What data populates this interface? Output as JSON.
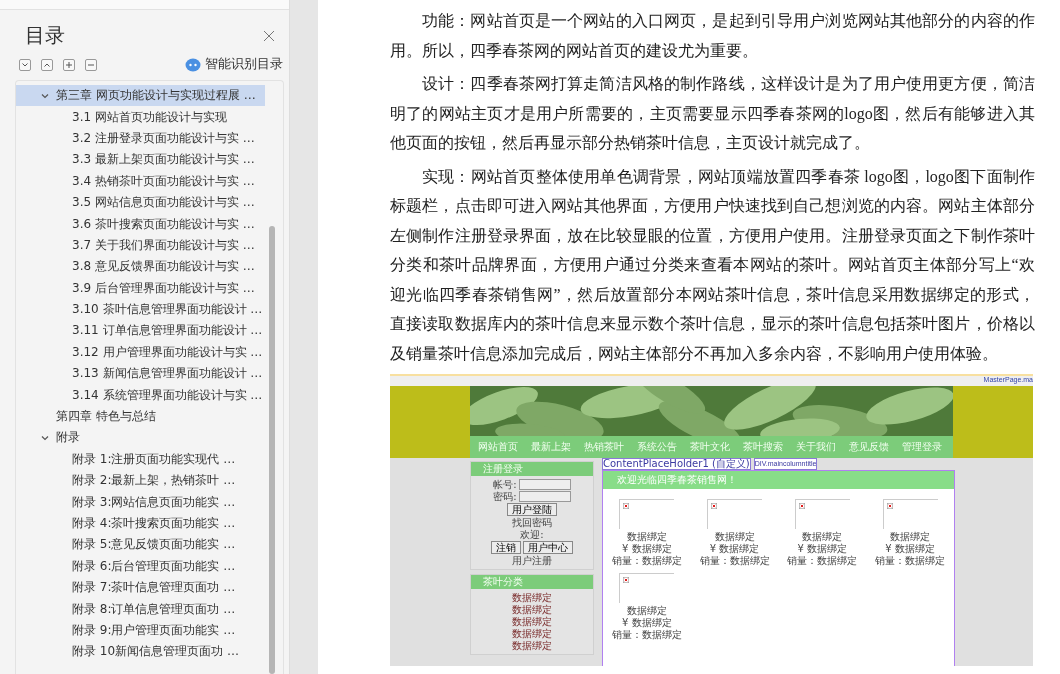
{
  "sidebar": {
    "title": "目录",
    "smart_toc": "智能识别目录",
    "tree": [
      {
        "label": "第三章 网页功能设计与实现过程展 …",
        "selected": true,
        "expanded": true,
        "children": [
          {
            "label": "3.1 网站首页功能设计与实现",
            "selected": false
          },
          {
            "label": "3.2 注册登录页面功能设计与实 …",
            "selected": false
          },
          {
            "label": "3.3 最新上架页面功能设计与实 …",
            "selected": false
          },
          {
            "label": "3.4 热销茶叶页面功能设计与实 …",
            "selected": false
          },
          {
            "label": "3.5 网站信息页面功能设计与实 …",
            "selected": false
          },
          {
            "label": "3.6 茶叶搜索页面功能设计与实 …",
            "selected": false
          },
          {
            "label": "3.7 关于我们界面功能设计与实 …",
            "selected": false
          },
          {
            "label": "3.8 意见反馈界面功能设计与实 …",
            "selected": false
          },
          {
            "label": "3.9 后台管理界面功能设计与实 …",
            "selected": false
          },
          {
            "label": "3.10 茶叶信息管理界面功能设计 …",
            "selected": false
          },
          {
            "label": "3.11 订单信息管理界面功能设计 …",
            "selected": false
          },
          {
            "label": "3.12 用户管理界面功能设计与实 …",
            "selected": false
          },
          {
            "label": "3.13 新闻信息管理界面功能设计 …",
            "selected": false
          },
          {
            "label": "3.14 系统管理界面功能设计与实 …",
            "selected": false
          }
        ]
      },
      {
        "label": "第四章 特色与总结",
        "selected": false
      },
      {
        "label": "附录",
        "selected": false,
        "expanded": true,
        "children": [
          {
            "label": "附录 1:注册页面功能实现代 …",
            "selected": false
          },
          {
            "label": "附录 2:最新上架，热销茶叶 …",
            "selected": false
          },
          {
            "label": "附录 3:网站信息页面功能实 …",
            "selected": false
          },
          {
            "label": "附录 4:茶叶搜索页面功能实 …",
            "selected": false
          },
          {
            "label": "附录 5:意见反馈页面功能实 …",
            "selected": false
          },
          {
            "label": "附录 6:后台管理页面功能实 …",
            "selected": false
          },
          {
            "label": "附录 7:茶叶信息管理页面功 …",
            "selected": false
          },
          {
            "label": "附录 8:订单信息管理页面功 …",
            "selected": false
          },
          {
            "label": "附录 9:用户管理页面功能实 …",
            "selected": false
          },
          {
            "label": "附录 10新闻信息管理页面功 …",
            "selected": false
          }
        ]
      }
    ]
  },
  "document": {
    "paragraphs": [
      "功能：网站首页是一个网站的入口网页，是起到引导用户浏览网站其他部分的内容的作用。所以，四季春茶网的网站首页的建设尤为重要。",
      "设计：四季春茶网打算走简洁风格的制作路线，这样设计是为了用户使用更方便，简洁明了的网站主页才是用户所需要的，主页需要显示四季春茶网的logo图，然后有能够进入其他页面的按钮，然后再显示部分热销茶叶信息，主页设计就完成了。",
      "实现：网站首页整体使用单色调背景，网站顶端放置四季春茶 logo图，logo图下面制作标题栏，点击即可进入网站其他界面，方便用户快速找到自己想浏览的内容。网站主体部分左侧制作注册登录界面，放在比较显眼的位置，方便用户使用。注册登录页面之下制作茶叶分类和茶叶品牌界面，方便用户通过分类来查看本网站的茶叶。网站首页主体部分写上“欢迎光临四季春茶销售网”，然后放置部分本网站茶叶信息，茶叶信息采用数据绑定的形式，直接读取数据库内的茶叶信息来显示数个茶叶信息，显示的茶叶信息包括茶叶图片，价格以及销量茶叶信息添加完成后，网站主体部分不再加入多余内容，不影响用户使用体验。"
    ],
    "screenshot": {
      "masterpage_label": "MasterPage.ma",
      "nav": [
        "网站首页",
        "最新上架",
        "热销茶叶",
        "系统公告",
        "茶叶文化",
        "茶叶搜索",
        "关于我们",
        "意见反馈",
        "管理登录"
      ],
      "login_panel": {
        "title": "注册登录",
        "account_label": "帐号:",
        "password_label": "密码:",
        "login_button": "用户登陆",
        "forgot_link": "找回密码",
        "welcome_label": "欢迎:",
        "logout_button": "注销",
        "user_center_button": "用户中心",
        "register_link": "用户注册"
      },
      "category_panel": {
        "title": "茶叶分类",
        "items": [
          "数据绑定",
          "数据绑定",
          "数据绑定",
          "数据绑定",
          "数据绑定"
        ]
      },
      "placeholder_label": "ContentPlaceHolder1 (自定义)",
      "div_label": "DIV.maincolumntitle",
      "welcome_title": "欢迎光临四季春茶销售网！",
      "products": [
        {
          "name": "数据绑定",
          "price": "¥ 数据绑定",
          "sales": "销量：数据绑定"
        },
        {
          "name": "数据绑定",
          "price": "¥ 数据绑定",
          "sales": "销量：数据绑定"
        },
        {
          "name": "数据绑定",
          "price": "¥ 数据绑定",
          "sales": "销量：数据绑定"
        },
        {
          "name": "数据绑定",
          "price": "¥ 数据绑定",
          "sales": "销量：数据绑定"
        },
        {
          "name": "数据绑定",
          "price": "¥ 数据绑定",
          "sales": "销量：数据绑定"
        }
      ]
    }
  }
}
